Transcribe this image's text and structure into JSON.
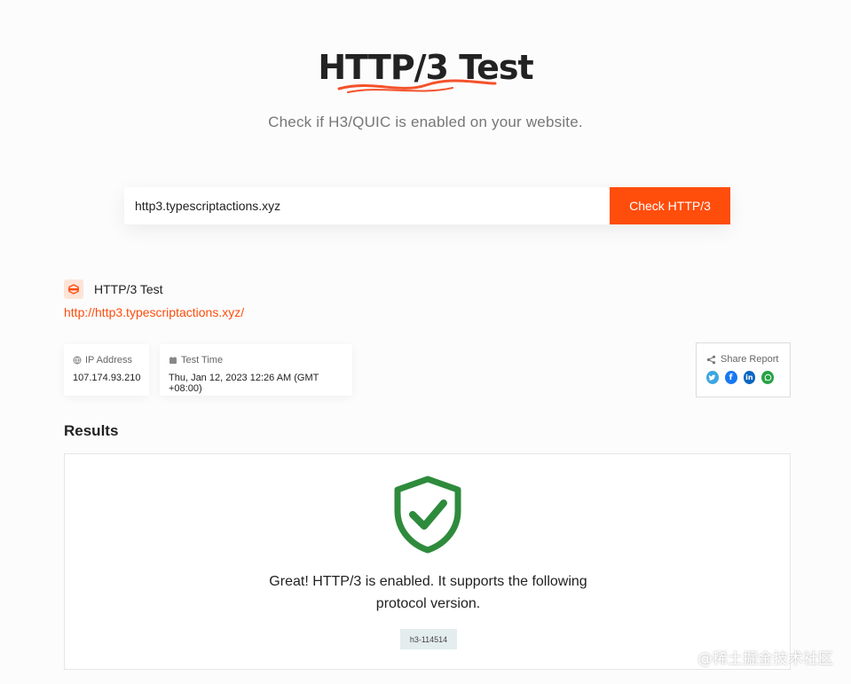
{
  "header": {
    "title": "HTTP/3 Test",
    "subtitle": "Check if H3/QUIC is enabled on your website."
  },
  "search": {
    "value": "http3.typescriptactions.xyz",
    "button_label": "Check HTTP/3"
  },
  "report": {
    "title": "HTTP/3 Test",
    "url": "http://http3.typescriptactions.xyz/",
    "ip_label": "IP Address",
    "ip_value": "107.174.93.210",
    "time_label": "Test Time",
    "time_value": "Thu, Jan 12, 2023 12:26 AM (GMT +08:00)",
    "share_label": "Share Report",
    "share_icons": [
      "twitter-icon",
      "facebook-icon",
      "linkedin-icon",
      "whatsapp-icon"
    ]
  },
  "results": {
    "heading": "Results",
    "message": "Great! HTTP/3 is enabled. It supports the following protocol version.",
    "versions": [
      "h3-114514"
    ]
  },
  "watermark": "@稀土掘金技术社区",
  "colors": {
    "accent": "#ff4d0c",
    "success": "#2e8b3c",
    "twitter": "#3ea6e0",
    "facebook": "#1877f2",
    "linkedin": "#0a66c2",
    "whatsapp": "#25a244"
  }
}
